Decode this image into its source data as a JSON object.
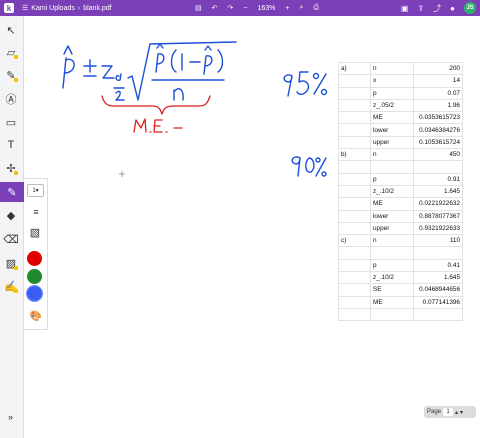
{
  "topbar": {
    "breadcrumb_folder": "Kami Uploads",
    "breadcrumb_file": "blank.pdf",
    "zoom_label": "163%",
    "user_initials": "JS",
    "accent_color": "#7b3fb8"
  },
  "tools": [
    "select-icon",
    "eraser-icon",
    "highlighter-icon",
    "text-annotation-icon",
    "comment-icon",
    "text-icon",
    "shapes-icon",
    "drawing-icon",
    "shape-icon",
    "eraser-icon",
    "image-icon",
    "signature-icon"
  ],
  "drawing_panel": {
    "size_value": "1",
    "colors": [
      "#e00000",
      "#1f8a2e",
      "#3a5cf0"
    ]
  },
  "sheet": {
    "rows": [
      [
        "a)",
        "n",
        "200"
      ],
      [
        "",
        "x",
        "14"
      ],
      [
        "",
        "p",
        "0.07"
      ],
      [
        "",
        "z_.05/2",
        "1.96"
      ],
      [
        "",
        "ME",
        "0.0353615723"
      ],
      [
        "",
        "lower",
        "0.0346384276"
      ],
      [
        "",
        "upper",
        "0.1053615724"
      ],
      [
        "b)",
        "n",
        "450"
      ],
      [
        "",
        "",
        ""
      ],
      [
        "",
        "p",
        "0.91"
      ],
      [
        "",
        "z_.10/2",
        "1.645"
      ],
      [
        "",
        "ME",
        "0.0221922632"
      ],
      [
        "",
        "lower",
        "0.8878077367"
      ],
      [
        "",
        "upper",
        "0.9321922633"
      ],
      [
        "c)",
        "n",
        "110"
      ],
      [
        "",
        "",
        ""
      ],
      [
        "",
        "p",
        "0.41"
      ],
      [
        "",
        "z_.10/2",
        "1.645"
      ],
      [
        "",
        "SE",
        "0.0468944656"
      ],
      [
        "",
        "ME",
        "0.077141396"
      ],
      [
        "",
        "",
        ""
      ]
    ]
  },
  "pager": {
    "label": "Page",
    "current": "1"
  }
}
